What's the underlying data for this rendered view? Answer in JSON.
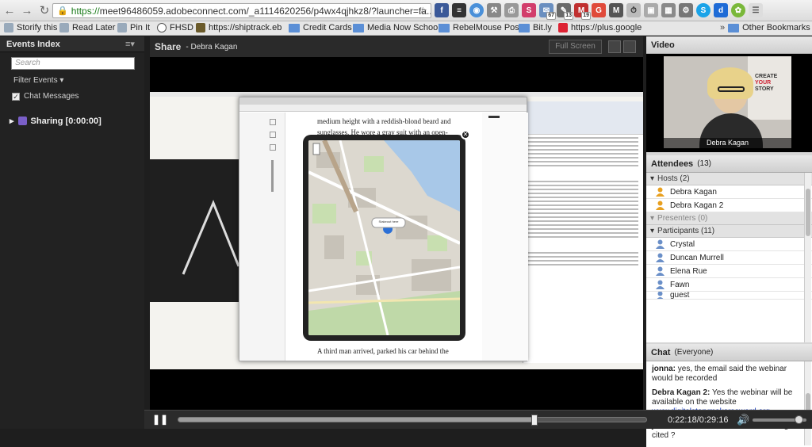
{
  "browser": {
    "url_scheme": "https://",
    "url_rest": "meet96486059.adobeconnect.com/_a1114620256/p4wx4qjhkz8/?launcher=fa...",
    "ext_badges": [
      "67",
      "13",
      "19"
    ]
  },
  "bookmarks": [
    {
      "label": "Storify this"
    },
    {
      "label": "Read Later"
    },
    {
      "label": "Pin It"
    },
    {
      "label": "FHSD"
    },
    {
      "label": "https://shiptrack.eb"
    },
    {
      "label": "Credit Cards"
    },
    {
      "label": "Media Now Schools"
    },
    {
      "label": "RebelMouse Post"
    },
    {
      "label": "Bit.ly"
    },
    {
      "label": "https://plus.google"
    },
    {
      "label": "Other Bookmarks"
    }
  ],
  "events": {
    "title": "Events Index",
    "search_placeholder": "Search",
    "filter_label": "Filter Events",
    "chat_messages_label": "Chat Messages",
    "sharing_item": "Sharing [0:00:00]"
  },
  "share": {
    "title": "Share",
    "presenter": "- Debra Kagan",
    "fullscreen": "Full Screen",
    "book_lines": [
      "medium height with a reddish-blond beard and",
      "sunglasses. He wore a gray suit with an open-",
      "A third man arrived, parked his car behind the"
    ],
    "map_label": "Stakeout here"
  },
  "video": {
    "title": "Video",
    "name": "Debra Kagan",
    "poster_text": [
      "CREATE",
      "YOUR",
      "STORY"
    ]
  },
  "attendees": {
    "title": "Attendees",
    "count": "(13)",
    "hosts_label": "Hosts (2)",
    "hosts": [
      "Debra Kagan",
      "Debra Kagan 2"
    ],
    "presenters_label": "Presenters (0)",
    "participants_label": "Participants (11)",
    "participants": [
      "Crystal",
      "Duncan Murrell",
      "Elena Rue",
      "Fawn",
      "guest"
    ]
  },
  "chat": {
    "title": "Chat",
    "scope": "(Everyone)",
    "messages": [
      {
        "author": "jonna:",
        "text": "yes, the email said the webinar would be recorded"
      },
      {
        "author": "Debra Kagan 2:",
        "text": "Yes the webinar will be available on the website",
        "link": "www.digitalstorymakersaward.org"
      },
      {
        "author": "jonna:",
        "text": "how are historical/archival images cited ?"
      }
    ]
  },
  "playback": {
    "time": "0:22:18/0:29:16",
    "progress": 0.7618,
    "volume": 0.85
  },
  "colors": {
    "accent_link": "#1a3dbf",
    "panel_dark": "#222222",
    "share_black": "#000000"
  }
}
